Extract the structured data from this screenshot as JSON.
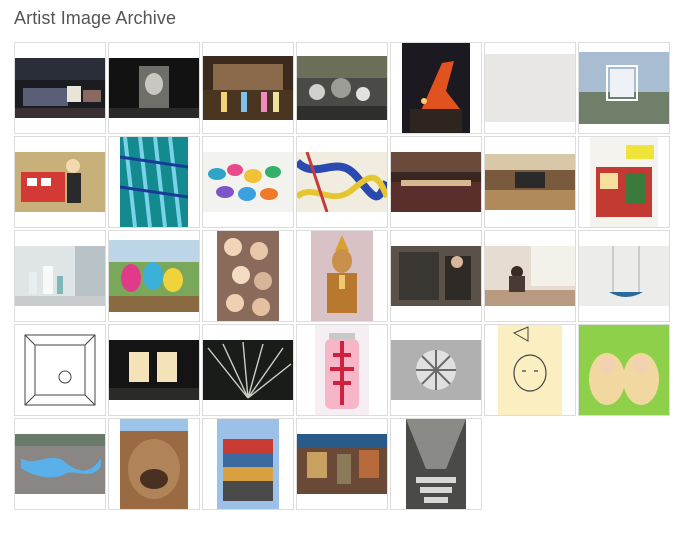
{
  "page": {
    "title": "Artist Image Archive"
  },
  "thumbnails": [
    {
      "id": "r1c1",
      "subject": "dark-installation-stage",
      "orientation": "landscape"
    },
    {
      "id": "r1c2",
      "subject": "dark-room-projection",
      "orientation": "landscape"
    },
    {
      "id": "r1c3",
      "subject": "lit-gallery-room",
      "orientation": "landscape"
    },
    {
      "id": "r1c4",
      "subject": "monochrome-sculpture-field",
      "orientation": "landscape"
    },
    {
      "id": "r1c5",
      "subject": "orange-sculpture-night",
      "orientation": "portrait"
    },
    {
      "id": "r1c6",
      "subject": "white-textured-wall",
      "orientation": "landscape"
    },
    {
      "id": "r1c7",
      "subject": "white-frame-landscape",
      "orientation": "landscape"
    },
    {
      "id": "r2c1",
      "subject": "woman-with-bus-cutout",
      "orientation": "landscape"
    },
    {
      "id": "r2c2",
      "subject": "blue-fern-pattern",
      "orientation": "portrait"
    },
    {
      "id": "r2c3",
      "subject": "painted-stones",
      "orientation": "landscape"
    },
    {
      "id": "r2c4",
      "subject": "abstract-paint-splash",
      "orientation": "landscape"
    },
    {
      "id": "r2c5",
      "subject": "crowded-exhibition-hall",
      "orientation": "landscape"
    },
    {
      "id": "r2c6",
      "subject": "gymnasium-performance",
      "orientation": "landscape"
    },
    {
      "id": "r2c7",
      "subject": "miniature-shop-model",
      "orientation": "portrait"
    },
    {
      "id": "r3c1",
      "subject": "white-vases-room",
      "orientation": "landscape"
    },
    {
      "id": "r3c2",
      "subject": "colorful-plush-figures",
      "orientation": "landscape"
    },
    {
      "id": "r3c3",
      "subject": "pile-of-dolls",
      "orientation": "portrait"
    },
    {
      "id": "r3c4",
      "subject": "golden-deity-figure",
      "orientation": "portrait"
    },
    {
      "id": "r3c5",
      "subject": "man-with-signboard",
      "orientation": "landscape"
    },
    {
      "id": "r3c6",
      "subject": "person-sitting-window",
      "orientation": "landscape"
    },
    {
      "id": "r3c7",
      "subject": "hanging-boat-installation",
      "orientation": "landscape"
    },
    {
      "id": "r4c1",
      "subject": "line-drawing-room",
      "orientation": "portrait"
    },
    {
      "id": "r4c2",
      "subject": "lit-doorways-night",
      "orientation": "landscape"
    },
    {
      "id": "r4c3",
      "subject": "peacock-display",
      "orientation": "landscape"
    },
    {
      "id": "r4c4",
      "subject": "pink-jar-sculpture",
      "orientation": "portrait"
    },
    {
      "id": "r4c5",
      "subject": "geometric-sphere",
      "orientation": "landscape"
    },
    {
      "id": "r4c6",
      "subject": "cartoon-character-drawing",
      "orientation": "portrait"
    },
    {
      "id": "r4c7",
      "subject": "peanut-mascot-poster",
      "orientation": "portrait"
    },
    {
      "id": "r5c1",
      "subject": "blue-inflatable-plaza",
      "orientation": "landscape"
    },
    {
      "id": "r5c2",
      "subject": "rock-formation",
      "orientation": "portrait"
    },
    {
      "id": "r5c3",
      "subject": "stacked-containers",
      "orientation": "portrait"
    },
    {
      "id": "r5c4",
      "subject": "cluttered-interior",
      "orientation": "landscape"
    },
    {
      "id": "r5c5",
      "subject": "monochrome-alley-text",
      "orientation": "portrait"
    }
  ]
}
